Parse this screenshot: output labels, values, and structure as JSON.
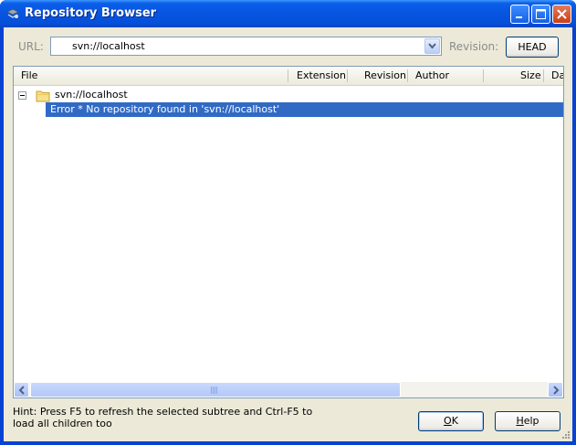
{
  "window": {
    "title": "Repository Browser"
  },
  "toolbar": {
    "url_label": "URL:",
    "url_value": "svn://localhost",
    "revision_label": "Revision:",
    "revision_button": "HEAD"
  },
  "list": {
    "columns": [
      "File",
      "Extension",
      "Revision",
      "Author",
      "Size",
      "Da"
    ],
    "tree": {
      "root_label": "svn://localhost",
      "error_text": "Error * No repository found in 'svn://localhost'"
    }
  },
  "footer": {
    "hint": "Hint: Press F5 to refresh the selected subtree and Ctrl-F5 to load all children too",
    "ok_mnemonic": "O",
    "ok_rest": "K",
    "help_mnemonic": "H",
    "help_rest": "elp"
  },
  "colors": {
    "titlebar": "#0754df",
    "selection": "#316ac5",
    "dialog_bg": "#ece9d8"
  },
  "icons": [
    "app-icon",
    "minimize-icon",
    "maximize-icon",
    "close-icon",
    "chevron-down-icon",
    "folder-icon",
    "collapse-icon",
    "arrow-left-icon",
    "arrow-right-icon"
  ]
}
